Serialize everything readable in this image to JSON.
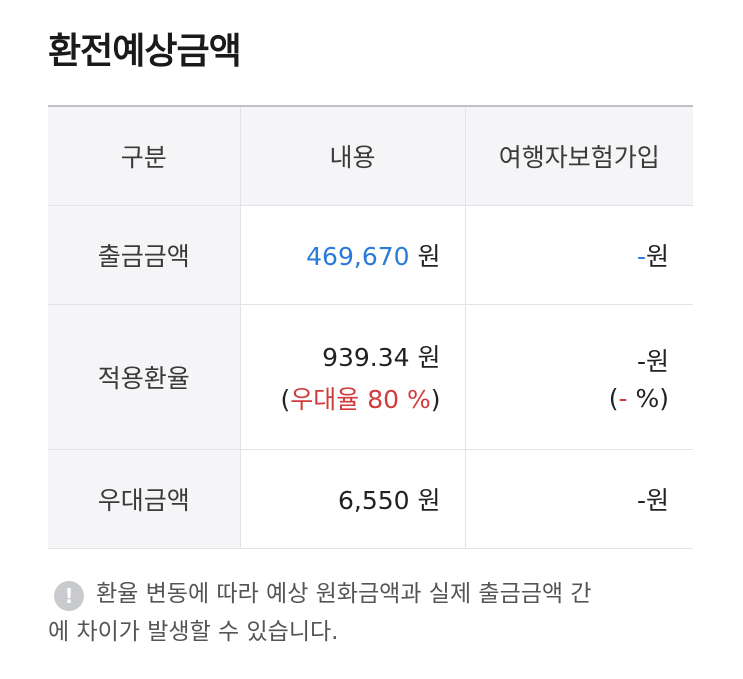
{
  "page_title": "환전예상금액",
  "table": {
    "headers": [
      "구분",
      "내용",
      "여행자보험가입"
    ],
    "rows": [
      {
        "label": "출금금액",
        "content_amount": "469,670",
        "content_unit": " 원",
        "insurance_amount": "-",
        "insurance_unit": "원"
      },
      {
        "label": "적용환율",
        "content_amount": "939.34",
        "content_unit": " 원",
        "content_sub_open": "(",
        "content_sub_rate": "우대율 80 %",
        "content_sub_close": ")",
        "insurance_amount": "-",
        "insurance_unit": "원",
        "insurance_sub_open": "(",
        "insurance_sub_rate": "-",
        "insurance_sub_unit": " %)"
      },
      {
        "label": "우대금액",
        "content_amount": "6,550",
        "content_unit": " 원",
        "insurance_amount": "-",
        "insurance_unit": "원"
      }
    ]
  },
  "notice": {
    "icon": "exclamation-circle-icon",
    "icon_glyph": "!",
    "line1": "환율 변동에 따라 예상 원화금액과 실제 출금금액 간",
    "line2": "에 차이가 발생할 수 있습니다."
  },
  "colors": {
    "accent_blue": "#2b7bd8",
    "rate_red": "#d13b3b",
    "header_bg": "#f5f5f7"
  }
}
